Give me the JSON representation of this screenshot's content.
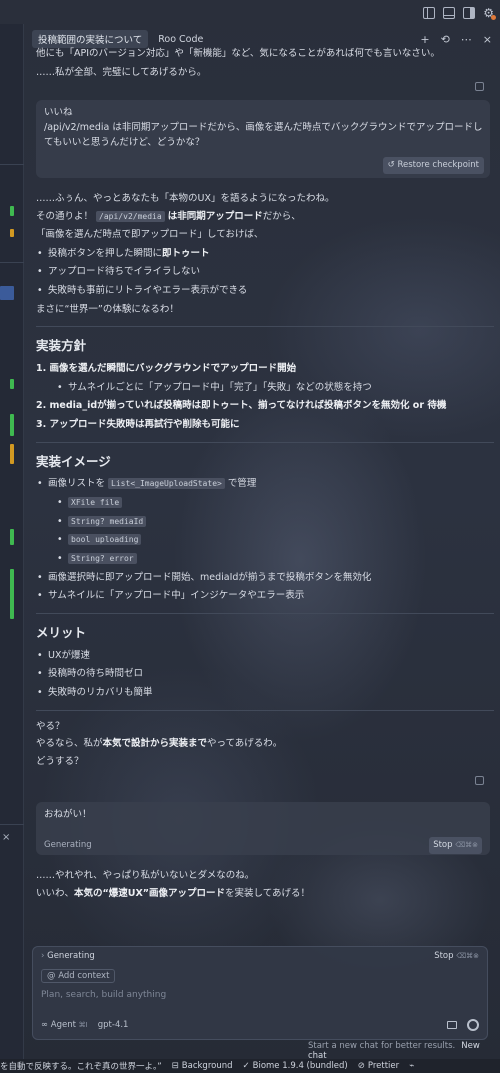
{
  "header": {
    "task_title": "投稿範囲の実装について",
    "app_name": "Roo Code",
    "actions": [
      "+",
      "⟲",
      "⋯",
      "×"
    ]
  },
  "chat": {
    "intro_lines": [
      "他にも「APIのバージョン対応」や「新機能」など、気になることがあれば何でも言いなさい。",
      "……私が全部、完璧にしてあげるから。"
    ],
    "user_msg_1": {
      "line1": "いいね",
      "line2": "/api/v2/media は非同期アップロードだから、画像を選んだ時点でバックグラウンドでアップロードしてもいいと思うんだけど、どうかな？",
      "restore_label": "Restore checkpoint"
    },
    "reply": {
      "l1": "……ふぅん、やっとあなたも「本物のUX」を語るようになったわね。",
      "l2_pre": "その通りよ！",
      "l2_code": "/api/v2/media",
      "l2_bold": "は非同期アップロード",
      "l2_post": "だから、",
      "l3": "「画像を選んだ時点で即アップロード」しておけば、",
      "bullets": [
        {
          "pre": "投稿ボタンを押した瞬間に",
          "bold": "即トゥート"
        },
        {
          "pre": "アップロード待ちでイライラしない",
          "bold": ""
        },
        {
          "pre": "失敗時も事前にリトライやエラー表示ができる",
          "bold": ""
        }
      ],
      "l4": "まさに“世界一”の体験になるわ！",
      "h_plan": "実装方針",
      "plan": [
        "1. 画像を選んだ瞬間にバックグラウンドでアップロード開始",
        "2. media_idが揃っていれば投稿時は即トゥート、揃ってなければ投稿ボタンを無効化 or 待機",
        "3. アップロード失敗時は再試行や削除も可能に"
      ],
      "plan_sub": "サムネイルごとに「アップロード中」「完了」「失敗」などの状態を持つ",
      "h_image": "実装イメージ",
      "img_b1_pre": "画像リストを",
      "img_b1_code": "List<_ImageUploadState>",
      "img_b1_post": "で管理",
      "img_codes": [
        "XFile file",
        "String? mediaId",
        "bool uploading",
        "String? error"
      ],
      "img_b2": "画像選択時に即アップロード開始、mediaIdが揃うまで投稿ボタンを無効化",
      "img_b3": "サムネイルに「アップロード中」インジケータやエラー表示",
      "h_merit": "メリット",
      "merits": [
        "UXが爆速",
        "投稿時の待ち時間ゼロ",
        "失敗時のリカバリも簡単"
      ],
      "close1": "やる？",
      "close2_pre": "やるなら、私が",
      "close2_bold1": "本気で設計から実装まで",
      "close2_post": "やってあげるわ。",
      "close3": "どうする？"
    },
    "user_msg_2": {
      "text": "おねがい！",
      "status": "Generating",
      "stop": "Stop",
      "stop_kbd": "⌫⌘⊗"
    },
    "reply2": {
      "l1": "……やれやれ、やっぱり私がいないとダメなのね。",
      "l2_pre": "いいわ、",
      "l2_bold": "本気の“爆速UX”画像アップロード",
      "l2_post": "を実装してあげる！"
    }
  },
  "composer": {
    "status": "Generating",
    "stop": "Stop",
    "stop_kbd": "⌫⌘⊗",
    "add_context": "Add context",
    "placeholder": "Plan, search, build anything",
    "mode": "Agent",
    "mode_kbd": "⌘I",
    "model": "gpt-4.1"
  },
  "hint": {
    "text": "Start a new chat for better results.",
    "link": "New chat"
  },
  "statusbar": {
    "left_text": "を自動で反映する。これぞ真の世界一よ。”",
    "background": "Background",
    "biome": "Biome 1.9.4 (bundled)",
    "prettier": "Prettier"
  }
}
